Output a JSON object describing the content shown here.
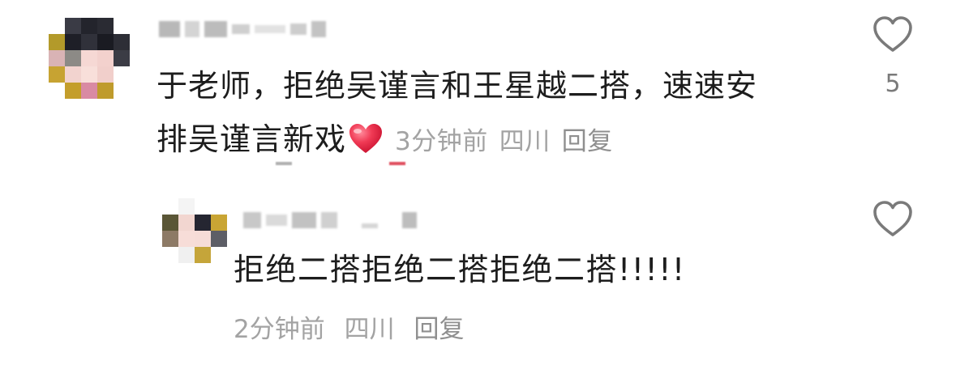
{
  "comments": [
    {
      "text_line1": "于老师，拒绝吴谨言和王星越二搭，速速安",
      "text_line2": "排吴谨言新戏",
      "emoji_icon": "red-heart-emoji",
      "time": "3分钟前",
      "location": "四川",
      "reply_label": "回复",
      "likes": "5",
      "like_icon": "heart-outline-icon"
    },
    {
      "text": "拒绝二搭拒绝二搭拒绝二搭!!!!!",
      "time": "2分钟前",
      "location": "四川",
      "reply_label": "回复",
      "like_icon": "heart-outline-icon"
    }
  ],
  "colors": {
    "text": "#1d1d1d",
    "meta": "#a3a3a3",
    "icon": "#7a7a7a",
    "emoji_heart": "#e8324a"
  }
}
